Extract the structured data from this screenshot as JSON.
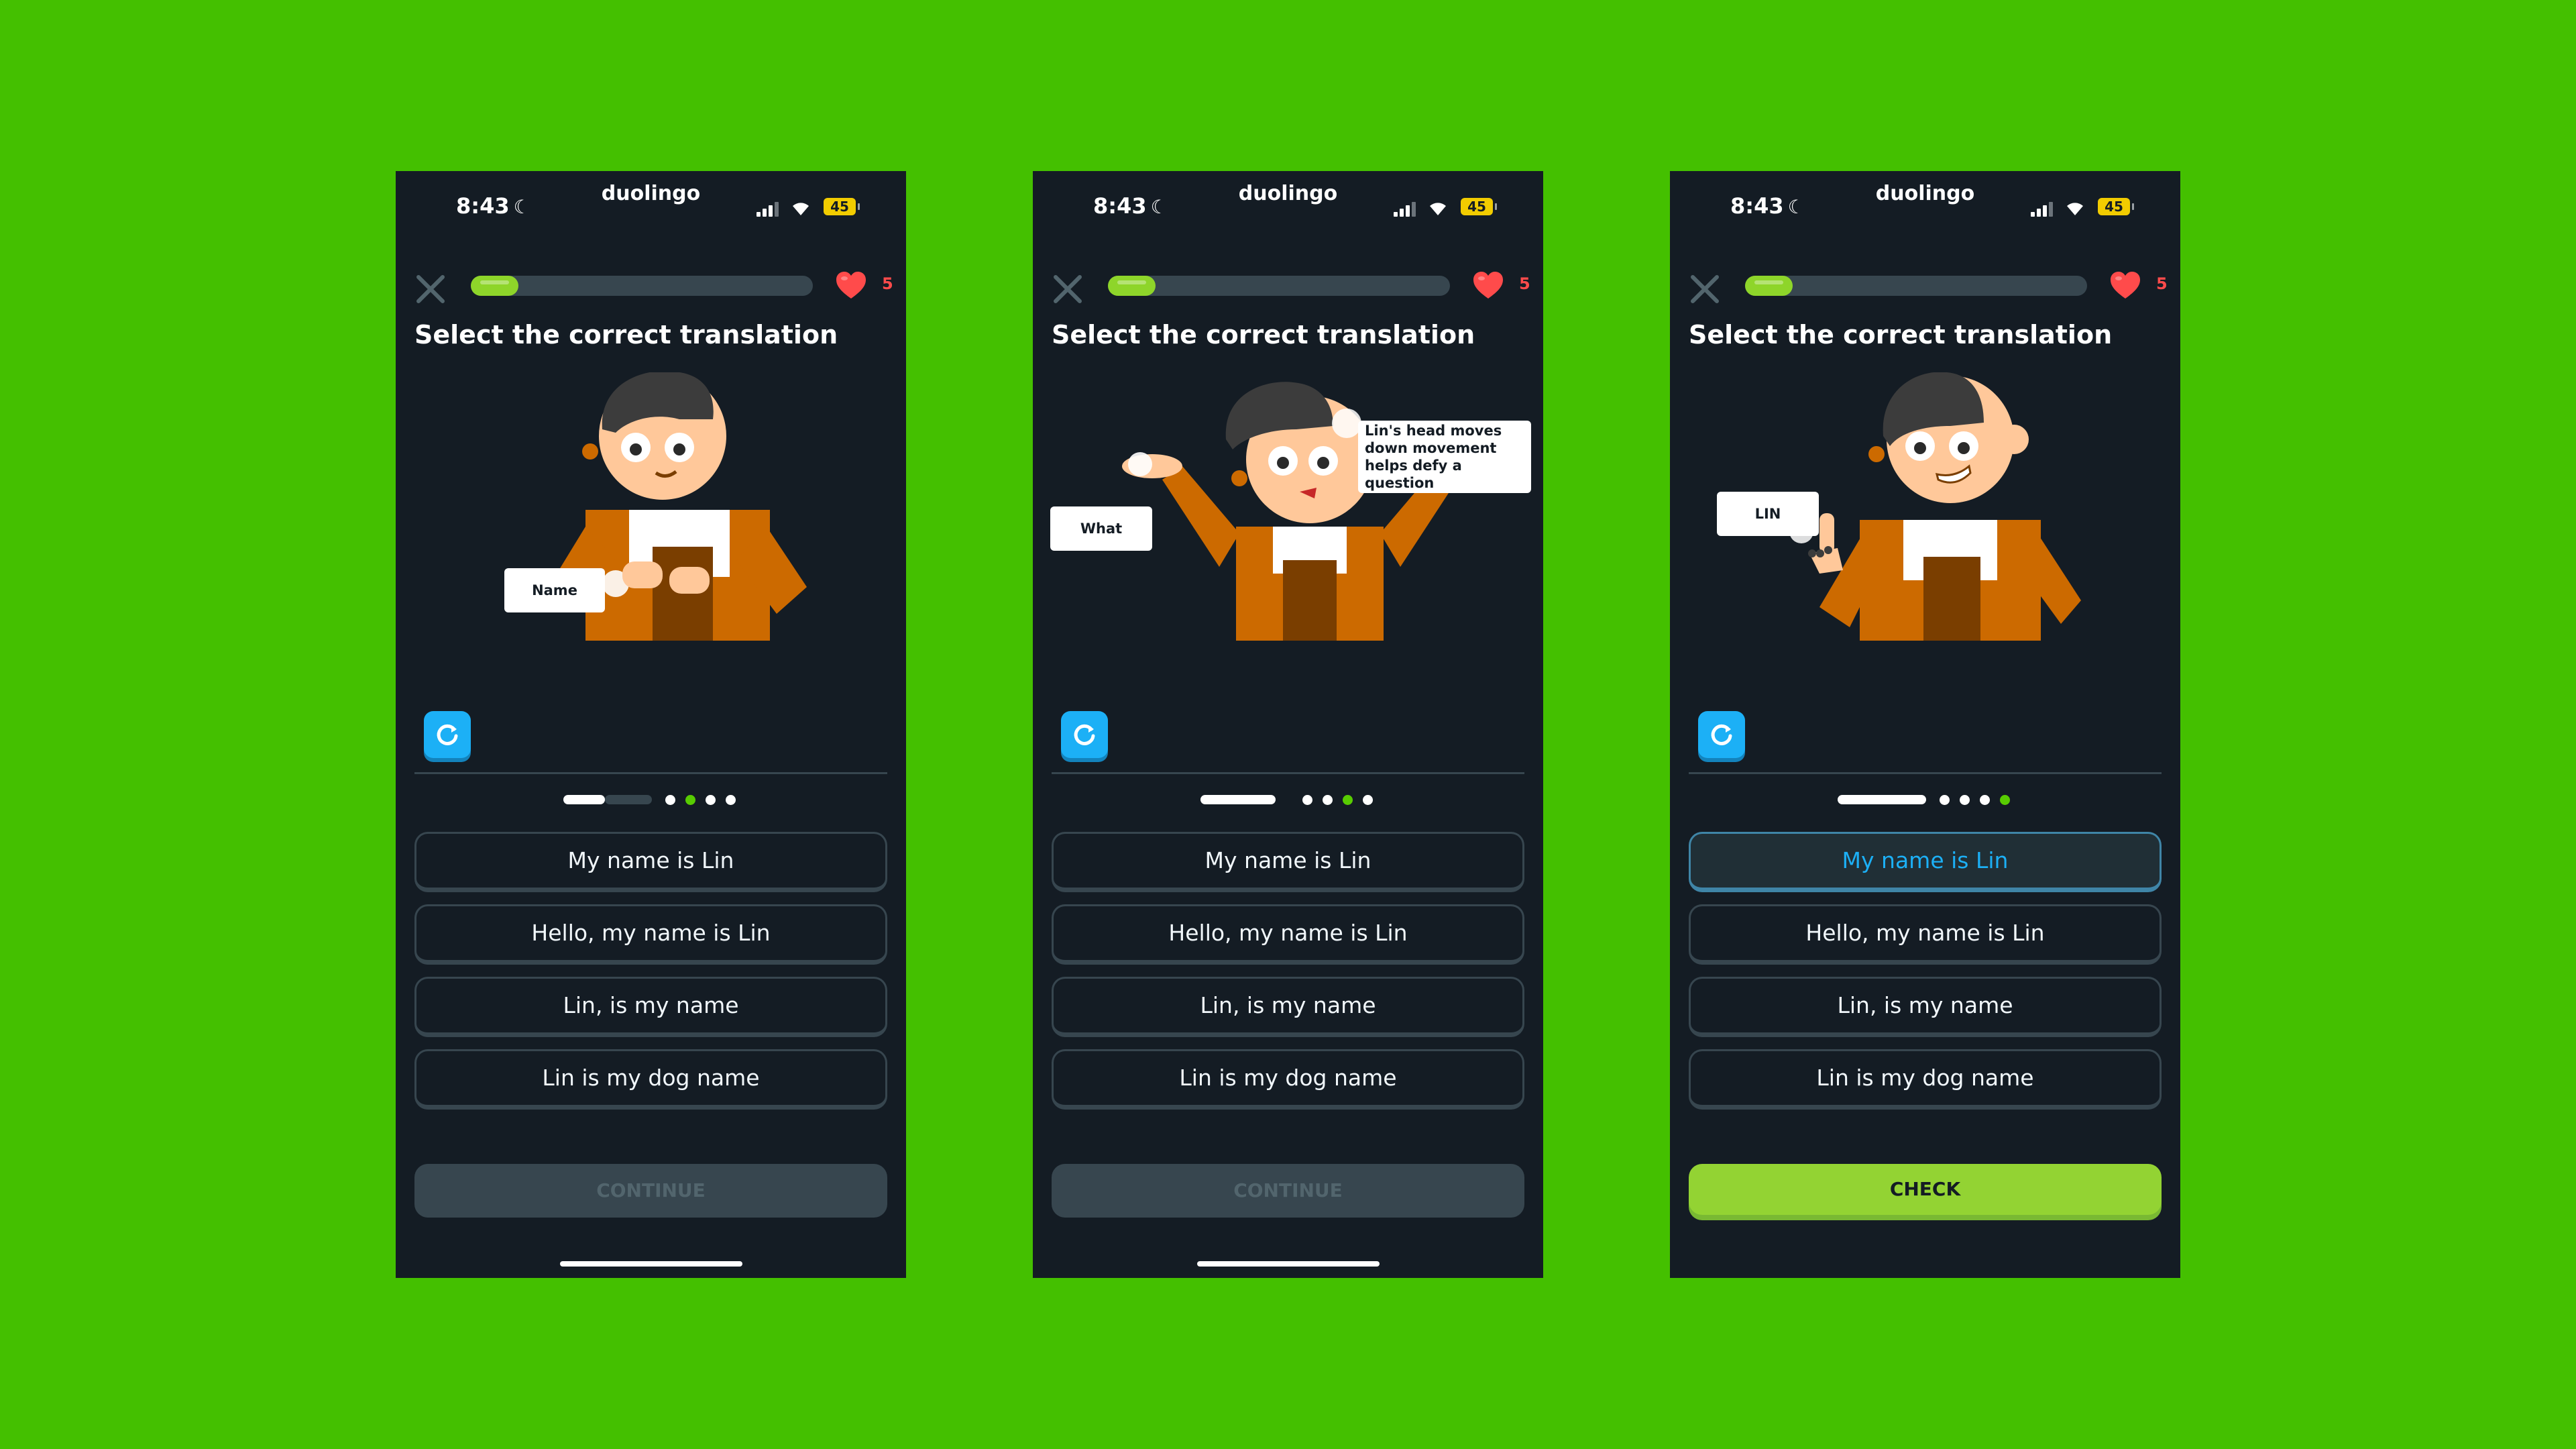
{
  "status_bar": {
    "time": "8:43",
    "app_name": "duolingo",
    "battery": "45"
  },
  "lesson": {
    "title": "Select the correct translation",
    "hearts": "5",
    "progress_fraction": 0.14,
    "options": [
      "My name is Lin",
      "Hello, my name is Lin",
      "Lin, is my name",
      "Lin is my dog name"
    ],
    "continue_label": "CONTINUE",
    "check_label": "CHECK"
  },
  "screens": [
    {
      "bubbles": [
        "Name"
      ]
    },
    {
      "bubbles": [
        "What",
        "Lin's head moves down movement helps defy a question"
      ]
    },
    {
      "bubbles": [
        "LIN"
      ],
      "selected_option": "My name is Lin"
    }
  ],
  "colors": {
    "background": "#44C000",
    "screen": "#141C24",
    "progress": "#8ED52A",
    "heart": "#FF4B4B",
    "replay": "#1CB0F6",
    "check": "#93D333",
    "selected_text": "#1CB0F6",
    "jacket": "#CC6A00"
  }
}
